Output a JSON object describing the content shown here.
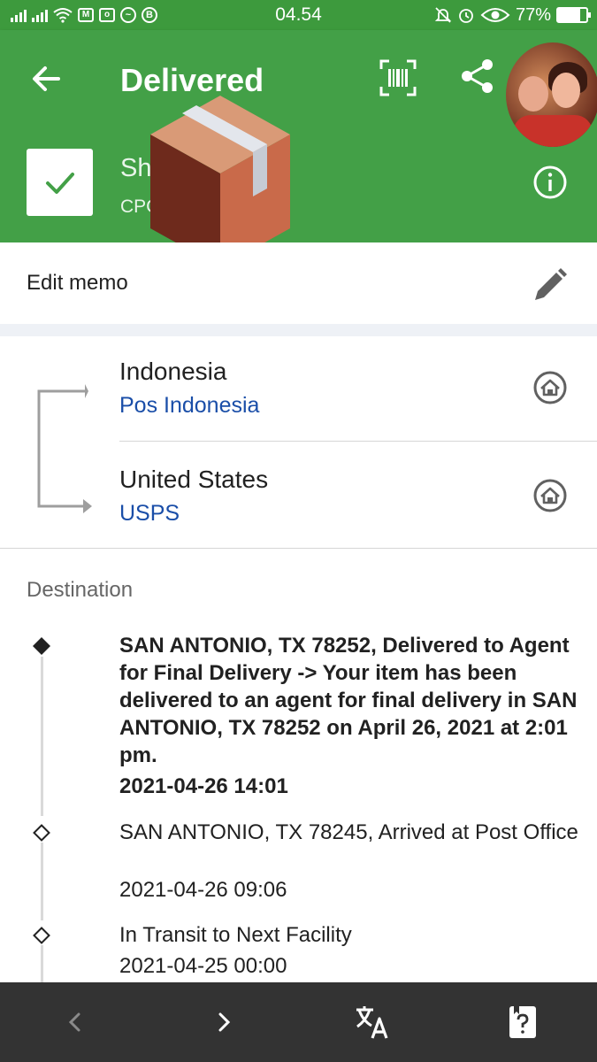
{
  "status_bar": {
    "time": "04.54",
    "battery": "77%",
    "battery_level": 0.77,
    "icons_left": [
      "signal-icon",
      "signal-icon",
      "wifi-icon",
      "gmail-icon",
      "instagram-icon",
      "messenger-icon",
      "b-app-icon"
    ],
    "icons_right": [
      "mute-icon",
      "alarm-icon",
      "eye-icon",
      "battery-icon"
    ]
  },
  "header": {
    "title": "Delivered",
    "item_name": "Sha",
    "item_code": "CPC",
    "background_color": "#43a047",
    "icons": [
      "back-arrow-icon",
      "barcode-scan-icon",
      "share-icon",
      "avatar",
      "check-icon",
      "info-icon",
      "package-emoji"
    ]
  },
  "memo": {
    "label": "Edit memo",
    "icon": "pencil-icon"
  },
  "route": {
    "origin": {
      "country": "Indonesia",
      "carrier": "Pos Indonesia"
    },
    "destination": {
      "country": "United States",
      "carrier": "USPS"
    },
    "carrier_color": "#1a4ea8"
  },
  "destination_section": {
    "label": "Destination",
    "events": [
      {
        "text": "SAN ANTONIO, TX 78252, Delivered to Agent for Final Delivery -> Your item has been delivered to an agent for final delivery in SAN ANTONIO, TX 78252 on April 26, 2021 at 2:01 pm.",
        "time": "2021-04-26 14:01",
        "latest": true
      },
      {
        "text": "SAN ANTONIO, TX 78245, Arrived at Post Office",
        "time": "2021-04-26 09:06",
        "latest": false
      },
      {
        "text": "In Transit to Next Facility",
        "time": "2021-04-25 00:00",
        "latest": false
      }
    ]
  },
  "bottom_nav": {
    "icons": [
      "chevron-left-icon",
      "chevron-right-icon",
      "translate-icon",
      "help-icon"
    ],
    "background_color": "#333333"
  }
}
